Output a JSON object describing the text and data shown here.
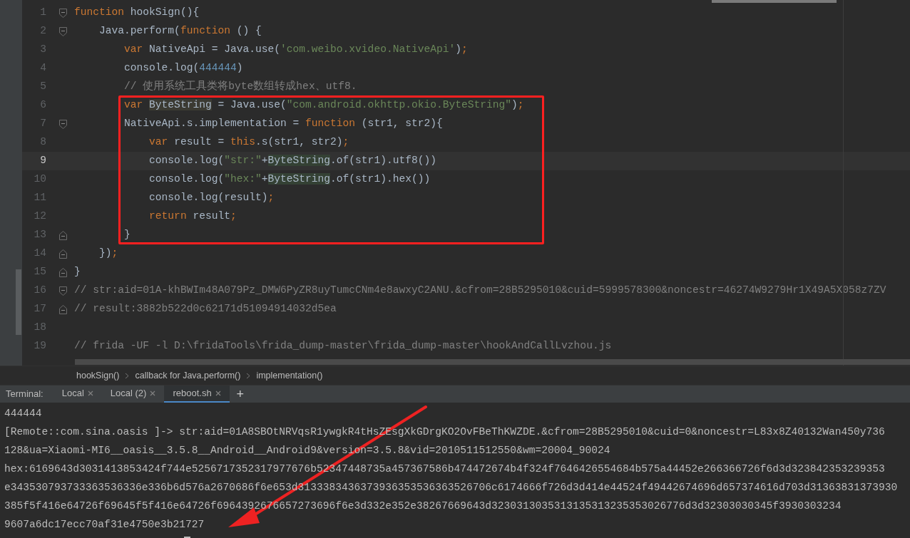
{
  "editor": {
    "lines": [
      {
        "number": "1",
        "fold_start": true,
        "current": false,
        "tokens": [
          {
            "kind": "keyword",
            "text": "function"
          },
          {
            "kind": "plain",
            "text": " hookSign(){"
          }
        ]
      },
      {
        "number": "2",
        "fold_start": true,
        "current": false,
        "tokens": [
          {
            "kind": "plain",
            "text": "    Java.perform("
          },
          {
            "kind": "keyword",
            "text": "function"
          },
          {
            "kind": "plain",
            "text": " () {"
          }
        ]
      },
      {
        "number": "3",
        "current": false,
        "tokens": [
          {
            "kind": "keyword",
            "text": "        var"
          },
          {
            "kind": "plain",
            "text": " NativeApi = Java.use("
          },
          {
            "kind": "string",
            "text": "'com.weibo.xvideo.NativeApi'"
          },
          {
            "kind": "plain",
            "text": ")"
          },
          {
            "kind": "keyword",
            "text": ";"
          }
        ]
      },
      {
        "number": "4",
        "current": false,
        "tokens": [
          {
            "kind": "plain",
            "text": "        console.log("
          },
          {
            "kind": "number",
            "text": "444444"
          },
          {
            "kind": "plain",
            "text": ")"
          }
        ]
      },
      {
        "number": "5",
        "current": false,
        "tokens": [
          {
            "kind": "comment",
            "text": "        // 使用系统工具类将byte数组转成hex、utf8."
          }
        ]
      },
      {
        "number": "6",
        "current": false,
        "tokens": [
          {
            "kind": "keyword",
            "text": "        var "
          },
          {
            "kind": "declared",
            "text": "ByteString"
          },
          {
            "kind": "plain",
            "text": " = Java.use("
          },
          {
            "kind": "string",
            "text": "\"com.android.okhttp.okio.ByteString\""
          },
          {
            "kind": "plain",
            "text": ")"
          },
          {
            "kind": "keyword",
            "text": ";"
          }
        ]
      },
      {
        "number": "7",
        "fold_start": true,
        "current": false,
        "tokens": [
          {
            "kind": "plain",
            "text": "        NativeApi.s.implementation = "
          },
          {
            "kind": "keyword",
            "text": "function"
          },
          {
            "kind": "plain",
            "text": " (str1, str2){"
          }
        ]
      },
      {
        "number": "8",
        "current": false,
        "tokens": [
          {
            "kind": "keyword",
            "text": "            var"
          },
          {
            "kind": "plain",
            "text": " result = "
          },
          {
            "kind": "keyword",
            "text": "this"
          },
          {
            "kind": "plain",
            "text": ".s(str1, str2)"
          },
          {
            "kind": "keyword",
            "text": ";"
          }
        ]
      },
      {
        "number": "9",
        "current": true,
        "tokens": [
          {
            "kind": "plain",
            "text": "            console.log("
          },
          {
            "kind": "string",
            "text": "\"str:\""
          },
          {
            "kind": "plain",
            "text": "+"
          },
          {
            "kind": "usage",
            "text": "ByteString"
          },
          {
            "kind": "plain",
            "text": ".of(str1).utf8())"
          }
        ]
      },
      {
        "number": "10",
        "current": false,
        "tokens": [
          {
            "kind": "plain",
            "text": "            console.log("
          },
          {
            "kind": "string",
            "text": "\"hex:\""
          },
          {
            "kind": "plain",
            "text": "+"
          },
          {
            "kind": "usage",
            "text": "ByteString"
          },
          {
            "kind": "plain",
            "text": ".of(str1).hex())"
          }
        ]
      },
      {
        "number": "11",
        "current": false,
        "tokens": [
          {
            "kind": "plain",
            "text": "            console.log(result)"
          },
          {
            "kind": "keyword",
            "text": ";"
          }
        ]
      },
      {
        "number": "12",
        "current": false,
        "tokens": [
          {
            "kind": "keyword",
            "text": "            return"
          },
          {
            "kind": "plain",
            "text": " result"
          },
          {
            "kind": "keyword",
            "text": ";"
          }
        ]
      },
      {
        "number": "13",
        "fold_end": true,
        "current": false,
        "tokens": [
          {
            "kind": "plain",
            "text": "        }"
          }
        ]
      },
      {
        "number": "14",
        "fold_end": true,
        "current": false,
        "tokens": [
          {
            "kind": "plain",
            "text": "    })"
          },
          {
            "kind": "keyword",
            "text": ";"
          }
        ]
      },
      {
        "number": "15",
        "fold_end": true,
        "current": false,
        "tokens": [
          {
            "kind": "plain",
            "text": "}"
          }
        ]
      },
      {
        "number": "16",
        "fold_start": true,
        "current": false,
        "tokens": [
          {
            "kind": "comment",
            "text": "// str:aid=01A-khBWIm48A079Pz_DMW6PyZR8uyTumcCNm4e8awxyC2ANU.&cfrom=28B5295010&cuid=5999578300&noncestr=46274W9279Hr1X49A5X058z7ZV"
          }
        ]
      },
      {
        "number": "17",
        "fold_end": true,
        "current": false,
        "tokens": [
          {
            "kind": "comment",
            "text": "// result:3882b522d0c62171d51094914032d5ea"
          }
        ]
      },
      {
        "number": "18",
        "current": false
      },
      {
        "number": "19",
        "current": false,
        "tokens": [
          {
            "kind": "comment",
            "text": "// frida -UF -l D:\\fridaTools\\frida_dump-master\\frida_dump-master\\hookAndCallLvzhou.js"
          }
        ]
      }
    ]
  },
  "breadcrumbs": [
    "hookSign()",
    "callback for Java.perform()",
    "implementation()"
  ],
  "terminal": {
    "label": "Terminal:",
    "tabs": [
      {
        "label": "Local",
        "selected": false
      },
      {
        "label": "Local (2)",
        "selected": false
      },
      {
        "label": "reboot.sh",
        "selected": true
      }
    ],
    "add_tab": "+",
    "lines": [
      "444444",
      "[Remote::com.sina.oasis ]-> str:aid=01A8SBOtNRVqsR1ywgkR4tHsZEsgXkGDrgKO2OvFBeThKWZDE.&cfrom=28B5295010&cuid=0&noncestr=L83x8Z40132Wan450y736",
      "128&ua=Xiaomi-MI6__oasis__3.5.8__Android__Android9&version=3.5.8&vid=2010511512550&wm=20004_90024",
      "hex:6169643d3031413853424f744e5256717352317977676b52347448735a457367586b474472674b4f324f7646426554684b575a44452e266366726f6d3d323842353239353",
      "e343530793733363536336e336b6d576a2670686f6e653d3133383436373936353536363526706c6174666f726d3d414e44524f49442674696d657374616d703d31363831373930",
      "385f5f416e64726f69645f5f416e64726f6964392676657273696f6e3d332e352e38267669643d3230313035313135313235353026776d3d32303030345f3930303234",
      "9607a6dc17ecc70af31e4750e3b21727"
    ]
  }
}
